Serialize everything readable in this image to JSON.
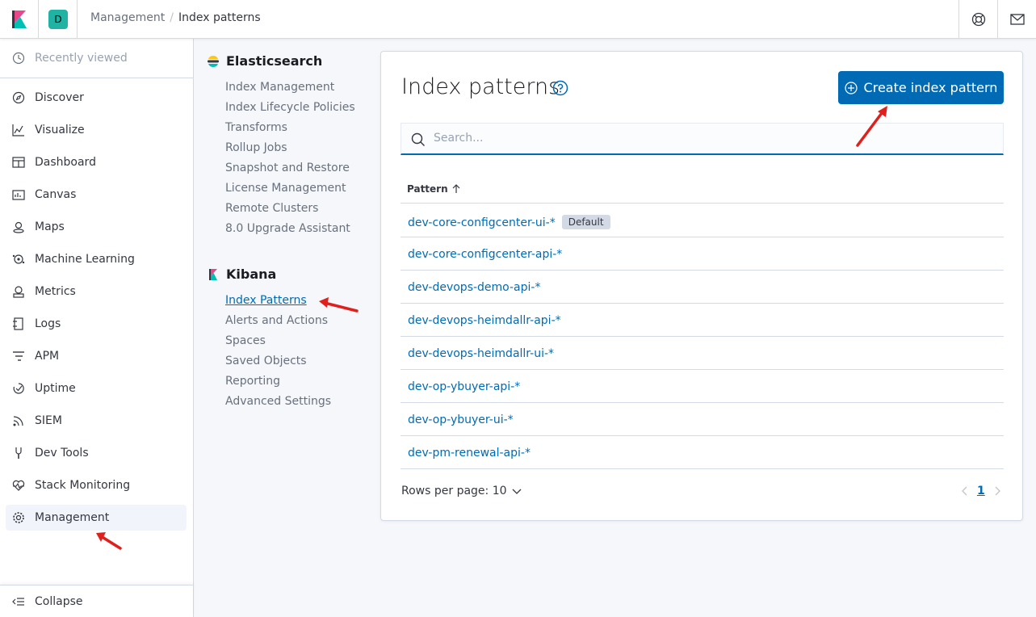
{
  "topbar": {
    "space_initial": "D",
    "breadcrumbs": [
      "Management",
      "Index patterns"
    ]
  },
  "leftnav": {
    "recent_label": "Recently viewed",
    "items": [
      {
        "label": "Discover",
        "icon": "compass-icon"
      },
      {
        "label": "Visualize",
        "icon": "visualize-icon"
      },
      {
        "label": "Dashboard",
        "icon": "dashboard-icon"
      },
      {
        "label": "Canvas",
        "icon": "canvas-icon"
      },
      {
        "label": "Maps",
        "icon": "maps-icon"
      },
      {
        "label": "Machine Learning",
        "icon": "machine-learning-icon"
      },
      {
        "label": "Metrics",
        "icon": "metrics-icon"
      },
      {
        "label": "Logs",
        "icon": "logs-icon"
      },
      {
        "label": "APM",
        "icon": "apm-icon"
      },
      {
        "label": "Uptime",
        "icon": "uptime-icon"
      },
      {
        "label": "SIEM",
        "icon": "siem-icon"
      },
      {
        "label": "Dev Tools",
        "icon": "dev-tools-icon"
      },
      {
        "label": "Stack Monitoring",
        "icon": "stack-monitoring-icon"
      },
      {
        "label": "Management",
        "icon": "gear-icon"
      }
    ],
    "collapse_label": "Collapse"
  },
  "mgmt_sidebar": {
    "elasticsearch_title": "Elasticsearch",
    "elasticsearch_links": [
      "Index Management",
      "Index Lifecycle Policies",
      "Transforms",
      "Rollup Jobs",
      "Snapshot and Restore",
      "License Management",
      "Remote Clusters",
      "8.0 Upgrade Assistant"
    ],
    "kibana_title": "Kibana",
    "kibana_links": [
      "Index Patterns",
      "Alerts and Actions",
      "Spaces",
      "Saved Objects",
      "Reporting",
      "Advanced Settings"
    ]
  },
  "main": {
    "title": "Index patterns",
    "create_button": "Create index pattern",
    "search_placeholder": "Search...",
    "column_header": "Pattern",
    "default_badge": "Default",
    "patterns": [
      "dev-core-configcenter-ui-*",
      "dev-core-configcenter-api-*",
      "dev-devops-demo-api-*",
      "dev-devops-heimdallr-api-*",
      "dev-devops-heimdallr-ui-*",
      "dev-op-ybuyer-api-*",
      "dev-op-ybuyer-ui-*",
      "dev-pm-renewal-api-*"
    ],
    "rows_per_page": "Rows per page: 10",
    "current_page": "1"
  },
  "colors": {
    "accent": "#006bb4",
    "annotation_arrow": "#e0201c"
  }
}
